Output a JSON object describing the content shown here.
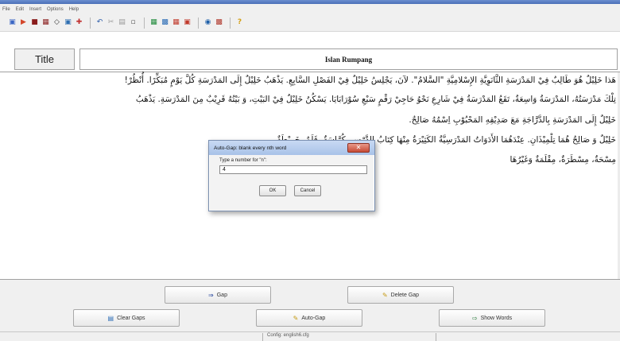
{
  "menu": [
    "File",
    "Edit",
    "Insert",
    "Options",
    "Help"
  ],
  "toolbar_icons": [
    "new-icon",
    "open-icon",
    "save-icon",
    "save-as-icon",
    "print-icon",
    "settings-icon",
    "color-icon",
    "undo-icon",
    "cut-icon",
    "copy-icon",
    "paste-icon",
    "check-icon",
    "preview-icon",
    "export-icon",
    "publish-icon",
    "web-icon",
    "book-icon",
    "help-icon"
  ],
  "title_label": "Title",
  "title_value": "Islan Rumpang",
  "body_lines": [
    "هَذا خَلِيْلٌ هُوَ طَالِبٌ فِيْ المَدْرَسَةِ الثَّانَوِيَّةِ الإِسْلامِيَّةِ \"السَّلامُ\". لآنَ، يَجْلِسُ خَلِيْلٌ فِيْ الفَصْلِ السَّابِعِ. يَذْهَبُ خَلِيْلٌ إِلَى المَدْرَسَةِ كُلَّ يَوْمٍ مُبَكِّرًا. أُنْظُرْ!",
    "تِلْكَ مَدْرَسَتُهُ، المَدْرَسَةُ وَاسِعَةٌ، تَقَعُ المَدْرَسَةُ فِيْ شَارِعِ نَحْوُ حَاجِيْ رَقْمٍ سَبْعِ سُوْرَابَايَا. يَسْكُنُ خَلِيْلٌ فِيْ البَيْتِ، وَ بَيْتُهُ قَرِيْبٌ مِنَ المَدْرَسَةِ. يَذْهَبُ",
    "خَلِيْلٌ إِلَى المَدْرَسَةِ بِالدَّرَّاجَةِ مَعَ صَدِيْقِهِ المَحْبُوْبِ اِسْمُهُ صَالِحٌ.",
    "خَلِيْلٌ وَ صَالِحٌ هُمَا تِلْمِيْذَانِ. عِنْدَهُمَا الأَدَوَاتُ المَدْرَسِيَّةُ الكَثِيْرَةُ مِنْهَا كِتَابُ الدَّرْسِ، كُرَّاسَةٌ، قَلَمٌ، خَرِيْطَةٌ،",
    "مِسْحَةٌ، مِسْطَرَةٌ، مِقْلَمَةٌ وَغَيْرُهَا"
  ],
  "buttons": {
    "gap": "Gap",
    "delete_gap": "Delete Gap",
    "clear_gaps": "Clear Gaps",
    "auto_gap": "Auto-Gap",
    "show_words": "Show Words"
  },
  "status": "Config: english6.cfg",
  "dialog": {
    "title": "Auto-Gap: blank every nth word",
    "prompt": "Type a number for \"n\":",
    "value": "4",
    "ok": "OK",
    "cancel": "Cancel"
  },
  "colors": {
    "dialog_title_bg": "#b8cdee",
    "close_button": "#c74a36"
  }
}
